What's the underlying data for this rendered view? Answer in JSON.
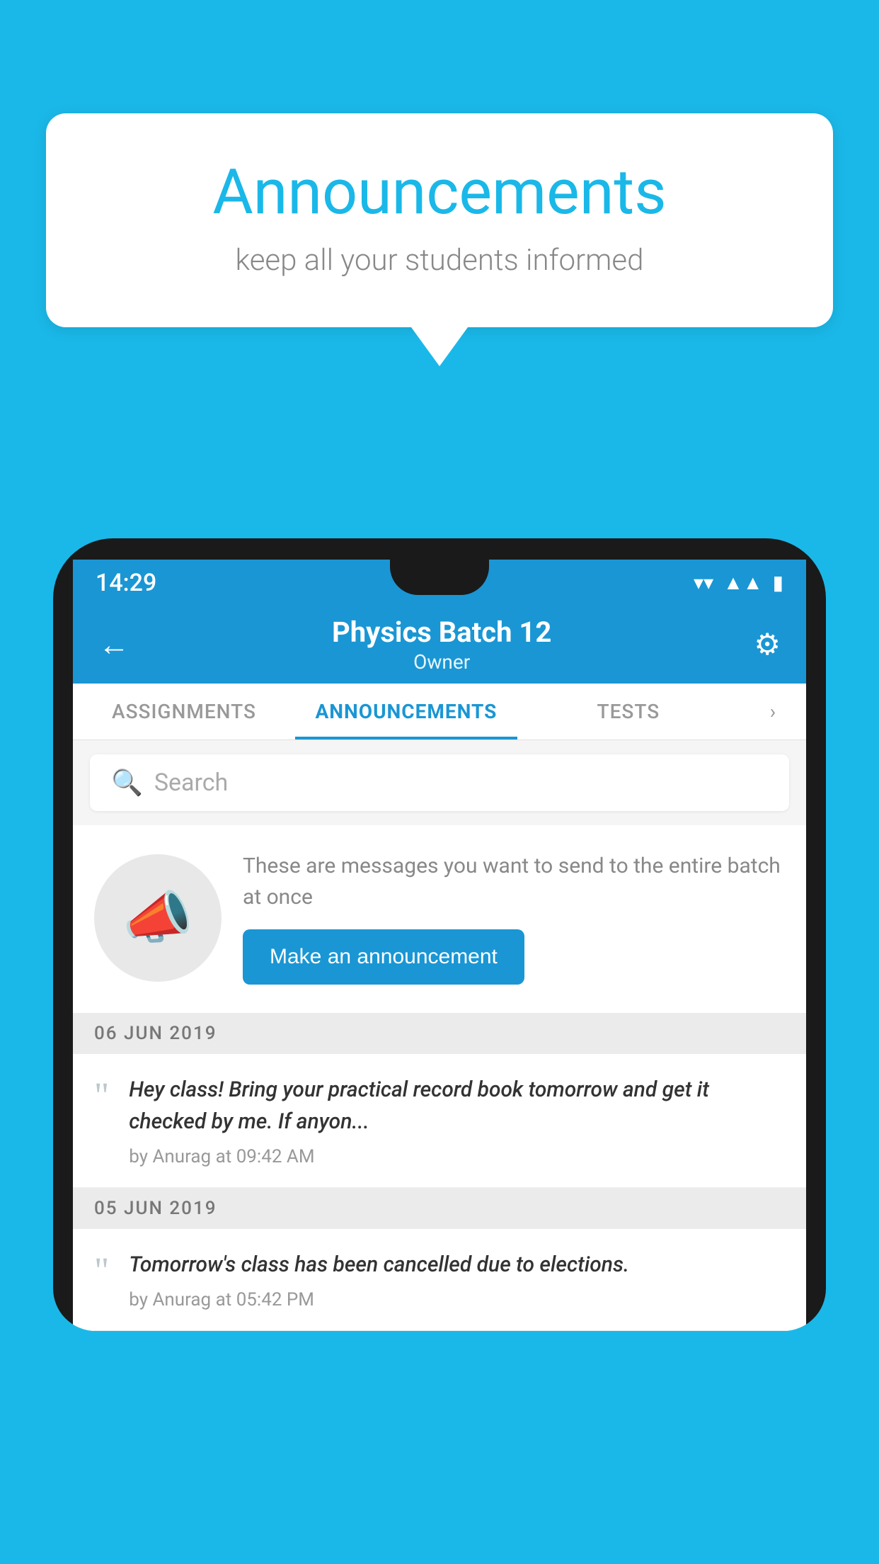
{
  "page": {
    "background_color": "#1ab8e8"
  },
  "speech_bubble": {
    "title": "Announcements",
    "subtitle": "keep all your students informed"
  },
  "phone": {
    "status_bar": {
      "time": "14:29",
      "wifi_icon": "wifi",
      "signal_icon": "signal",
      "battery_icon": "battery"
    },
    "app_bar": {
      "back_label": "←",
      "title": "Physics Batch 12",
      "subtitle": "Owner",
      "settings_icon": "⚙"
    },
    "tabs": [
      {
        "label": "ASSIGNMENTS",
        "active": false
      },
      {
        "label": "ANNOUNCEMENTS",
        "active": true
      },
      {
        "label": "TESTS",
        "active": false
      }
    ],
    "search": {
      "placeholder": "Search"
    },
    "promo": {
      "description": "These are messages you want to send to the entire batch at once",
      "button_label": "Make an announcement"
    },
    "announcements": [
      {
        "date": "06  JUN  2019",
        "text": "Hey class! Bring your practical record book tomorrow and get it checked by me. If anyon...",
        "meta": "by Anurag at 09:42 AM"
      },
      {
        "date": "05  JUN  2019",
        "text": "Tomorrow's class has been cancelled due to elections.",
        "meta": "by Anurag at 05:42 PM"
      }
    ]
  }
}
